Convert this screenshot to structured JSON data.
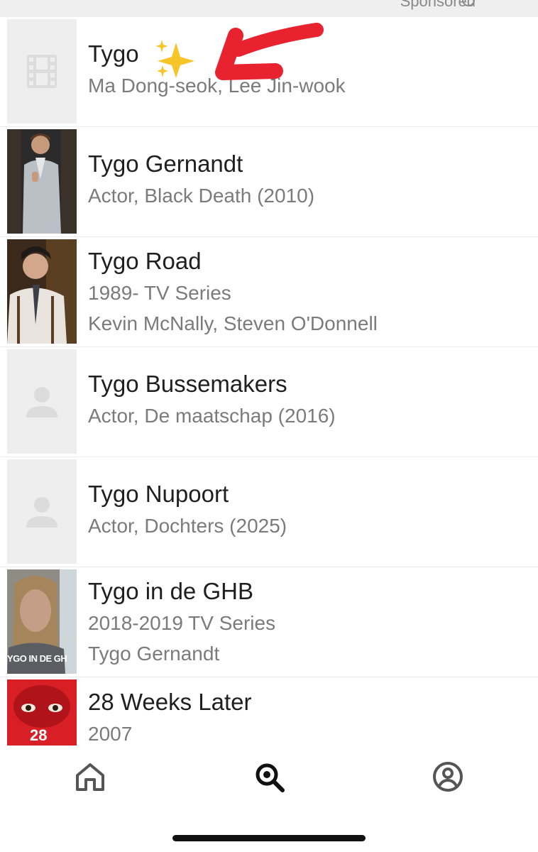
{
  "header": {
    "sponsored_label": "Sponsored",
    "info_icon": "info-icon"
  },
  "results": [
    {
      "title": "Tygo",
      "lines": [
        "Ma Dong-seok, Lee Jin-wook"
      ],
      "thumb": "film-placeholder-icon",
      "annotation": "sparkles-emoji"
    },
    {
      "title": "Tygo Gernandt",
      "lines": [
        "Actor, Black Death (2010)"
      ],
      "thumb": "photo"
    },
    {
      "title": "Tygo Road",
      "lines": [
        "1989-  TV Series",
        "Kevin McNally, Steven O'Donnell"
      ],
      "thumb": "photo"
    },
    {
      "title": "Tygo Bussemakers",
      "lines": [
        "Actor, De maatschap (2016)"
      ],
      "thumb": "person-placeholder-icon"
    },
    {
      "title": "Tygo Nupoort",
      "lines": [
        "Actor, Dochters (2025)"
      ],
      "thumb": "person-placeholder-icon"
    },
    {
      "title": "Tygo in de GHB",
      "lines": [
        "2018-2019  TV Series",
        "Tygo Gernandt"
      ],
      "thumb": "photo",
      "thumb_caption": "YGO IN DE GH"
    },
    {
      "title": "28 Weeks Later",
      "lines": [
        "2007"
      ],
      "thumb": "poster",
      "thumb_caption": "28"
    }
  ],
  "tabbar": {
    "tabs": [
      "home-icon",
      "search-icon",
      "account-icon"
    ],
    "active": "search-icon"
  },
  "colors": {
    "annotation_arrow": "#e8232f",
    "active_tab": "#111111",
    "inactive_tab": "#555555"
  }
}
